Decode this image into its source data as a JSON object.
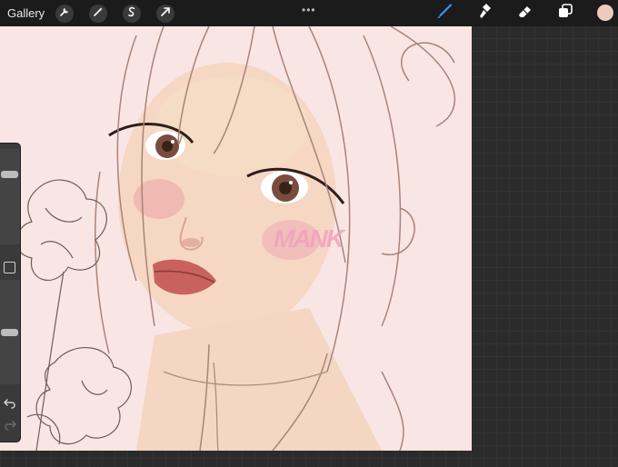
{
  "app": {
    "gallery_label": "Gallery",
    "more_label": "•••"
  },
  "toolbar": {
    "left_tools": [
      "wrench-icon",
      "magic-wand-icon",
      "selection-icon",
      "transform-arrow-icon"
    ],
    "right_tools": [
      "brush-icon",
      "smudge-icon",
      "eraser-icon",
      "layers-icon"
    ],
    "active_tool": "brush",
    "current_color": "#efc9bb"
  },
  "canvas": {
    "background_color": "#f9e5e4",
    "watermark": "MANK",
    "watermark_color": "#f2a1c0"
  },
  "sidebar": {
    "brush_size": 0.75,
    "opacity": 0.5
  }
}
